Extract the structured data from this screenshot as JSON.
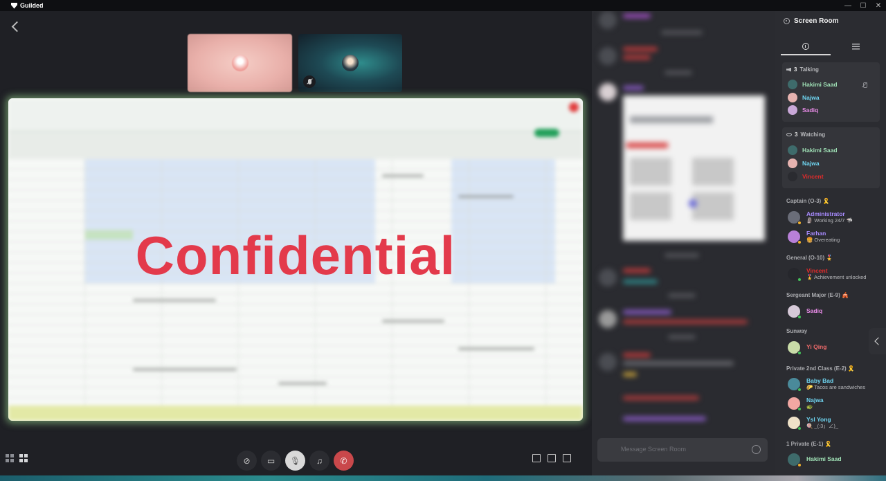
{
  "app": {
    "name": "Guilded"
  },
  "window_controls": {
    "minimize": "—",
    "maximize": "☐",
    "close": "✕"
  },
  "stage": {
    "watermark": "Confidential",
    "thumbnails": [
      {
        "name": "participant-1",
        "avatar_color": "#f1a7a2"
      },
      {
        "name": "participant-2",
        "avatar_color": "#2a3b45",
        "muted": true
      }
    ]
  },
  "controls": {
    "buttons": [
      "stop-screenshare",
      "camera-off",
      "mute-mic",
      "headphones",
      "end-call"
    ]
  },
  "chat": {
    "input_placeholder": "Message Screen Room"
  },
  "panel": {
    "title": "Screen Room",
    "talking": {
      "count": "3",
      "label": "Talking",
      "members": [
        {
          "name": "Hakimi Saad",
          "color": "#9fe0b5",
          "muted": true
        },
        {
          "name": "Najwa",
          "color": "#6fd6f2"
        },
        {
          "name": "Sadiq",
          "color": "#e98ce8"
        }
      ]
    },
    "watching": {
      "count": "3",
      "label": "Watching",
      "members": [
        {
          "name": "Hakimi Saad",
          "color": "#9fe0b5"
        },
        {
          "name": "Najwa",
          "color": "#6fd6f2"
        },
        {
          "name": "Vincent",
          "color": "#e02b2b"
        }
      ]
    },
    "roles": [
      {
        "title": "Captain (O-3) 🎗️",
        "members": [
          {
            "name": "Administrator",
            "color": "#a88bff",
            "status": "🗿 Working 24/7 🦈"
          },
          {
            "name": "Farhan",
            "color": "#a88bff",
            "status": "🍔 Overeating"
          }
        ]
      },
      {
        "title": "General (O-10) 🎖️",
        "members": [
          {
            "name": "Vincent",
            "color": "#e02b2b",
            "status": "🎖️ Achievement unlocked"
          }
        ]
      },
      {
        "title": "Sergeant Major (E-9) 🎪",
        "members": [
          {
            "name": "Sadiq",
            "color": "#e98ce8",
            "status": ""
          }
        ]
      },
      {
        "title": "Sunway",
        "members": [
          {
            "name": "Yi Qing",
            "color": "#f06b6b",
            "status": ""
          }
        ]
      },
      {
        "title": "Private 2nd Class (E-2) 🎗️",
        "members": [
          {
            "name": "Baby Bad",
            "color": "#6fd6f2",
            "status": "🌮 Tacos are sandwiches"
          },
          {
            "name": "Najwa",
            "color": "#6fd6f2",
            "status": "🐢"
          },
          {
            "name": "Ysl Yong",
            "color": "#6fd6f2",
            "status": "🍭 _(:3」∠)_"
          }
        ]
      },
      {
        "title": "1 Private (E-1) 🎗️",
        "members": [
          {
            "name": "Hakimi Saad",
            "color": "#9fe0b5",
            "status": ""
          }
        ]
      }
    ]
  }
}
